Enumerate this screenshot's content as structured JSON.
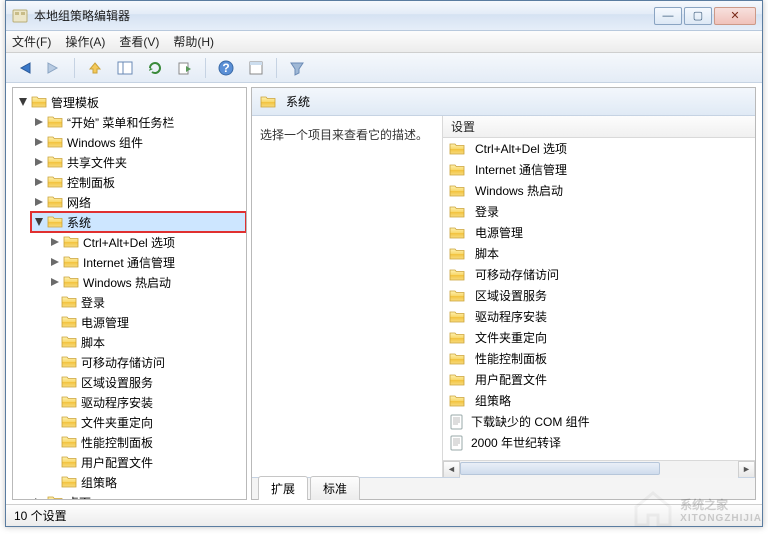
{
  "window": {
    "title": "本地组策略编辑器",
    "btn_min": "—",
    "btn_max": "▢",
    "btn_close": "✕"
  },
  "menu": {
    "file": "文件(F)",
    "action": "操作(A)",
    "view": "查看(V)",
    "help": "帮助(H)"
  },
  "tree": {
    "root": "管理模板",
    "items": [
      "“开始” 菜单和任务栏",
      "Windows 组件",
      "共享文件夹",
      "控制面板",
      "网络"
    ],
    "selected": "系统",
    "system_children": [
      "Ctrl+Alt+Del 选项",
      "Internet 通信管理",
      "Windows 热启动",
      "登录",
      "电源管理",
      "脚本",
      "可移动存储访问",
      "区域设置服务",
      "驱动程序安装",
      "文件夹重定向",
      "性能控制面板",
      "用户配置文件",
      "组策略"
    ],
    "tail": "桌面"
  },
  "right": {
    "heading": "系统",
    "description": "选择一个项目来查看它的描述。",
    "column": "设置",
    "items": [
      {
        "type": "folder",
        "label": "Ctrl+Alt+Del 选项"
      },
      {
        "type": "folder",
        "label": "Internet 通信管理"
      },
      {
        "type": "folder",
        "label": "Windows 热启动"
      },
      {
        "type": "folder",
        "label": "登录"
      },
      {
        "type": "folder",
        "label": "电源管理"
      },
      {
        "type": "folder",
        "label": "脚本"
      },
      {
        "type": "folder",
        "label": "可移动存储访问"
      },
      {
        "type": "folder",
        "label": "区域设置服务"
      },
      {
        "type": "folder",
        "label": "驱动程序安装"
      },
      {
        "type": "folder",
        "label": "文件夹重定向"
      },
      {
        "type": "folder",
        "label": "性能控制面板"
      },
      {
        "type": "folder",
        "label": "用户配置文件"
      },
      {
        "type": "folder",
        "label": "组策略"
      },
      {
        "type": "setting",
        "label": "下载缺少的 COM 组件"
      },
      {
        "type": "setting",
        "label": "2000 年世纪转译"
      }
    ],
    "tabs": {
      "extended": "扩展",
      "standard": "标准"
    }
  },
  "status": "10 个设置",
  "watermark": {
    "line1": "系统之家",
    "line2": "XITONGZHIJIA"
  }
}
